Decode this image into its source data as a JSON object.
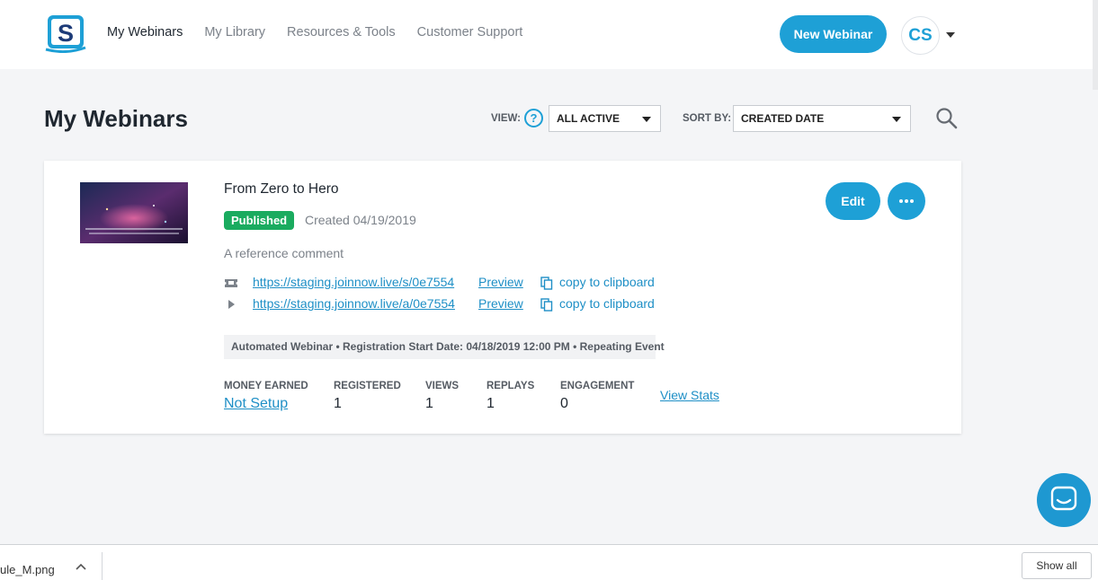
{
  "header": {
    "nav": [
      {
        "label": "My Webinars",
        "active": true
      },
      {
        "label": "My Library",
        "active": false
      },
      {
        "label": "Resources & Tools",
        "active": false
      },
      {
        "label": "Customer Support",
        "active": false
      }
    ],
    "new_webinar_label": "New Webinar",
    "avatar_initials": "CS"
  },
  "page": {
    "title": "My Webinars",
    "view_label": "VIEW:",
    "view_help": "?",
    "view_value": "ALL ACTIVE",
    "sort_label": "SORT BY:",
    "sort_value": "CREATED DATE"
  },
  "webinar": {
    "title": "From Zero to Hero",
    "status": "Published",
    "created": "Created 04/19/2019",
    "comment": "A reference comment",
    "links": [
      {
        "icon": "ticket-icon",
        "url": "https://staging.joinnow.live/s/0e7554",
        "preview": "Preview",
        "copy": "copy to clipboard"
      },
      {
        "icon": "play-icon",
        "url": "https://staging.joinnow.live/a/0e7554",
        "preview": "Preview",
        "copy": "copy to clipboard"
      }
    ],
    "info": "Automated Webinar • Registration Start Date: 04/18/2019 12:00 PM • Repeating Event",
    "stats": [
      {
        "label": "MONEY EARNED",
        "value": "Not Setup"
      },
      {
        "label": "REGISTERED",
        "value": "1"
      },
      {
        "label": "VIEWS",
        "value": "1"
      },
      {
        "label": "REPLAYS",
        "value": "1"
      },
      {
        "label": "ENGAGEMENT",
        "value": "0"
      }
    ],
    "view_stats": "View Stats",
    "edit_label": "Edit"
  },
  "download_bar": {
    "file_name": "ule_M.png",
    "show_all": "Show all"
  },
  "colors": {
    "accent": "#1ea0d6",
    "published": "#1aab5f",
    "link": "#1e8fc6"
  }
}
